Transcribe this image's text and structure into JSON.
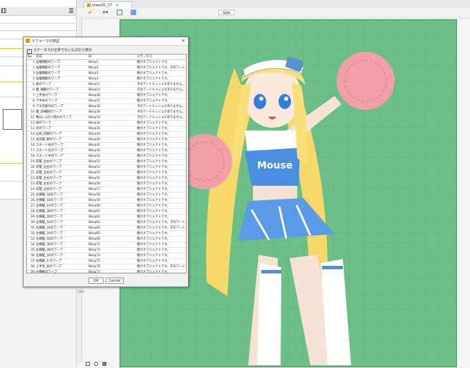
{
  "tab": {
    "title": "cheer01_07"
  },
  "toolbar": {
    "solo_label": "Solo"
  },
  "ruler": {
    "mark": "1000"
  },
  "dialog": {
    "title": "デフォーマの検証",
    "checkbox_label": "ステータスが正常でないものだけ表示",
    "checkbox_checked": true,
    "columns": [
      "No",
      "名前",
      "ID",
      "ステータス"
    ],
    "rows": [
      {
        "no": "1",
        "name": "左瞳閉動のワープ",
        "id": "Warp1",
        "status": "親がオブジェクトです。"
      },
      {
        "no": "2",
        "name": "右瞳閉動のワープ",
        "id": "Warp2",
        "status": "親がオブジェクトです。子のアートメ..."
      },
      {
        "no": "3",
        "name": "左瞳閉動のワープ",
        "id": "Warp3",
        "status": "親がオブジェクトです。"
      },
      {
        "no": "4",
        "name": "右瞳閉動のワープ",
        "id": "Warp4",
        "status": "親がオブジェクトです。"
      },
      {
        "no": "5",
        "name": "眉のワープ",
        "id": "Warp11",
        "status": "子のアートメッシュがありません。"
      },
      {
        "no": "6",
        "name": "髪_横動のワープ",
        "id": "Warp14",
        "status": "子のアートメッシュがありません。"
      },
      {
        "no": "7",
        "name": "上半身のワープ",
        "id": "Warp36",
        "status": "親がオブジェクトです。"
      },
      {
        "no": "8",
        "name": "下半身のワープ",
        "id": "Warp37",
        "status": "親がオブジェクトです。"
      },
      {
        "no": "9",
        "name": "アホ毛動作のワープ",
        "id": "Warp38",
        "status": "子のアートメッシュがありません。"
      },
      {
        "no": "10",
        "name": "髪_前横動のワープ",
        "id": "Warp39",
        "status": "子のアートメッシュがありません。"
      },
      {
        "no": "11",
        "name": "胸(おっぱい)揺れのワープ",
        "id": "Warp33",
        "status": "子のアートメッシュがありません。"
      },
      {
        "no": "12",
        "name": "顔のワープ",
        "id": "Warp34",
        "status": "親がオブジェクトです。"
      },
      {
        "no": "13",
        "name": "首のワープ",
        "id": "Warp35",
        "status": "親がオブジェクトです。"
      },
      {
        "no": "14",
        "name": "左肩_前腕のワープ",
        "id": "Warp44",
        "status": "親がオブジェクトです。"
      },
      {
        "no": "15",
        "name": "左前腕_腕のワープ",
        "id": "Warp40",
        "status": "親がオブジェクトです。"
      },
      {
        "no": "16",
        "name": "スカート右のワープ",
        "id": "Warp41",
        "status": "親がオブジェクトです。"
      },
      {
        "no": "17",
        "name": "スカート左のワープ",
        "id": "Warp42",
        "status": "親がオブジェクトです。"
      },
      {
        "no": "18",
        "name": "スカート中のワープ",
        "id": "Warp43",
        "status": "親がオブジェクトです。"
      },
      {
        "no": "19",
        "name": "前髪_左右のワープ",
        "id": "Warp52",
        "status": "親がオブジェクトです。"
      },
      {
        "no": "20",
        "name": "前髪_左右のワープ",
        "id": "Warp53",
        "status": "親がオブジェクトです。"
      },
      {
        "no": "21",
        "name": "前髪_左右のワープ",
        "id": "Warp54",
        "status": "親がオブジェクトです。"
      },
      {
        "no": "22",
        "name": "前髪_左右のワープ",
        "id": "Warp55",
        "status": "親がオブジェクトです。"
      },
      {
        "no": "23",
        "name": "前髪_左右のワープ",
        "id": "Warp56",
        "status": "親がオブジェクトです。"
      },
      {
        "no": "24",
        "name": "前髪_左右のワープ",
        "id": "Warp57",
        "status": "親がオブジェクトです。"
      },
      {
        "no": "25",
        "name": "左横髪_1Bのワープ",
        "id": "Warp58",
        "status": "親がオブジェクトです。"
      },
      {
        "no": "26",
        "name": "左横髪_1Bのワープ",
        "id": "Warp59",
        "status": "親がオブジェクトです。"
      },
      {
        "no": "27",
        "name": "左横髪_1Aのワープ",
        "id": "Warp60",
        "status": "親がオブジェクトです。"
      },
      {
        "no": "28",
        "name": "左横髪_2Bのワープ",
        "id": "Warp61",
        "status": "親がオブジェクトです。"
      },
      {
        "no": "29",
        "name": "左横髪_2Bのワープ",
        "id": "Warp62",
        "status": "親がオブジェクトです。"
      },
      {
        "no": "30",
        "name": "左横髪_2Aのワープ",
        "id": "Warp63",
        "status": "親がオブジェクトです。子のアートメ..."
      },
      {
        "no": "31",
        "name": "左横髪_2Aのワープ",
        "id": "Warp64",
        "status": "親がオブジェクトです。子のアートメ..."
      },
      {
        "no": "32",
        "name": "左横髪_3Aのワープ",
        "id": "Warp65",
        "status": "親がオブジェクトです。"
      },
      {
        "no": "33",
        "name": "左横髪_1Bのワープ",
        "id": "Warp66",
        "status": "親がオブジェクトです。"
      },
      {
        "no": "34",
        "name": "左横髪_3Bのワープ",
        "id": "Warp72",
        "status": "親がオブジェクトです。"
      },
      {
        "no": "35",
        "name": "左横髪_2Bのワープ",
        "id": "Warp73",
        "status": "親がオブジェクトです。"
      },
      {
        "no": "36",
        "name": "左横髪_2Aのワープ",
        "id": "Warp74",
        "status": "親がオブジェクトです。"
      },
      {
        "no": "37",
        "name": "右横髪_A のワープ",
        "id": "Warp75",
        "status": "親がオブジェクトです。"
      },
      {
        "no": "38",
        "name": "上半身_右のワープ",
        "id": "Warp76",
        "status": "親がオブジェクトです。子のアートメ..."
      },
      {
        "no": "39",
        "name": "左横動のワープ",
        "id": "Warp77",
        "status": "親がオブジェクトです。"
      },
      {
        "no": "40",
        "name": "左横動_B のワープ",
        "id": "Warp76",
        "status": "親がオブジェクトです。子のアートメ..."
      },
      {
        "no": "41",
        "name": "左横髪_Aのワープ",
        "id": "Warp77",
        "status": "親がオブジェクトです。"
      },
      {
        "no": "42",
        "name": "左横髪_3のワープ",
        "id": "Warp78",
        "status": "親がオブジェクトです。"
      },
      {
        "no": "43",
        "name": "左横髪_3Aのワープ",
        "id": "Warp79",
        "status": "親がオブジェクトです。"
      },
      {
        "no": "44",
        "name": "口開閉のワープ",
        "id": "Warp79",
        "status": "親がオブジェクトです。"
      }
    ],
    "ok_label": "OK",
    "cancel_label": "Cancel"
  },
  "canvas": {
    "background_color": "#6bbf87",
    "character_text": "Mouse"
  },
  "colors": {
    "accent": "#f29100",
    "hair": "#f8df7a",
    "uniform_blue": "#4a8fe0",
    "pompom": "#f2a0a8"
  }
}
